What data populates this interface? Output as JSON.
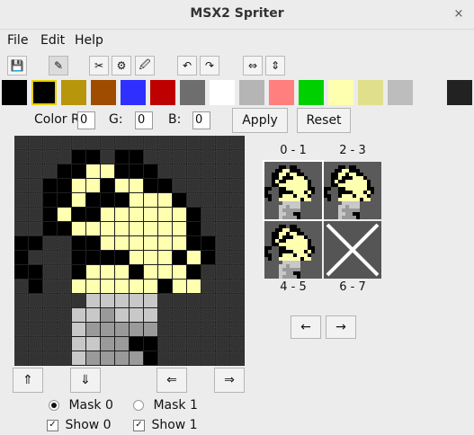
{
  "window": {
    "title": "MSX2 Spriter",
    "close_glyph": "×"
  },
  "menu": {
    "file": "File",
    "edit": "Edit",
    "help": "Help"
  },
  "toolbar": {
    "save": "💾",
    "pen": "✎",
    "cut": "✂",
    "fill": "⚙",
    "pipette": "🖉",
    "undo": "↶",
    "redo": "↷",
    "flip_h": "⇔",
    "flip_v": "⇕"
  },
  "palette": {
    "selected_index": 1,
    "colors": [
      "#000000",
      "#000000",
      "#b8960c",
      "#a04c00",
      "#2f2fff",
      "#bf0000",
      "#6e6e6e",
      "#ffffff",
      "#b5b5b5",
      "#ff7f7f",
      "#00d000",
      "#ffffb0",
      "#e0e08c",
      "#bdbdbd",
      "#ececec",
      "#222222"
    ]
  },
  "color_editor": {
    "label_r": "Color R",
    "r": "0",
    "label_g": "G:",
    "g": "0",
    "label_b": "B:",
    "b": "0",
    "apply": "Apply",
    "reset": "Reset"
  },
  "thumbnails": [
    {
      "label": "0 - 1"
    },
    {
      "label": "2 - 3"
    },
    {
      "label": "4 - 5"
    },
    {
      "label": "6 - 7"
    }
  ],
  "nav": {
    "prev": "←",
    "next": "→"
  },
  "shift": {
    "up": "⇑",
    "down": "⇓",
    "left": "⇐",
    "right": "⇒"
  },
  "mask": {
    "mask0": "Mask 0",
    "mask1": "Mask 1",
    "show0": "Show 0",
    "show1": "Show 1",
    "check_glyph": "✓"
  },
  "sprite_grid": [
    "................",
    "....##.##.......",
    "...##YY###......",
    "..##YY#YY##.....",
    "..##Y###YYY#....",
    "..#Y##YYYYYY#...",
    "..##YYYYYYYY#...",
    "##..##YYYYYY##..",
    "#...####YYY#Y#..",
    "##..#YYY#YYY#...",
    ".#..YYYYYY#YY...",
    ".....+++++......",
    "....++=+++......",
    "....+=====......",
    "....++==##......",
    "....+====#......"
  ]
}
